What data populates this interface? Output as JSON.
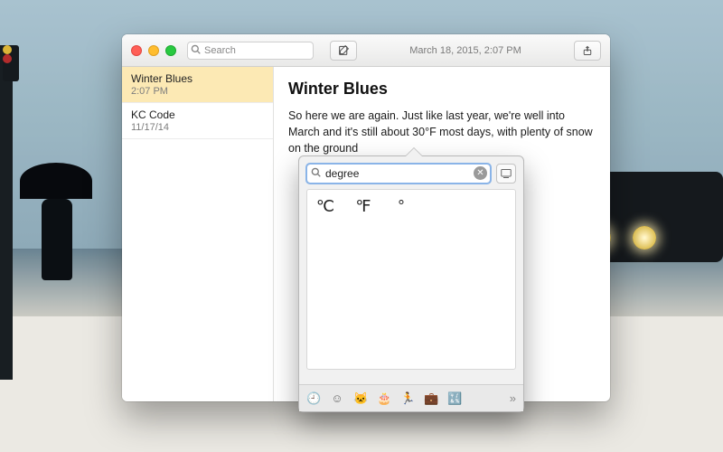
{
  "header": {
    "sidebar_search_placeholder": "Search",
    "date_label": "March 18, 2015, 2:07 PM"
  },
  "sidebar": {
    "items": [
      {
        "title": "Winter Blues",
        "subtitle": "2:07 PM",
        "selected": true
      },
      {
        "title": "KC Code",
        "subtitle": "11/17/14",
        "selected": false
      }
    ]
  },
  "editor": {
    "title": "Winter Blues",
    "body": "So here we are again. Just like last year, we're well into March and it's still about 30°F most days, with plenty of snow on the ground"
  },
  "char_viewer": {
    "search_value": "degree",
    "results": [
      {
        "char": "℃",
        "name": "degree-celsius"
      },
      {
        "char": "℉",
        "name": "degree-fahrenheit"
      },
      {
        "char": "°",
        "name": "degree-sign"
      }
    ],
    "categories": [
      {
        "icon": "🕘",
        "name": "recent"
      },
      {
        "icon": "☺",
        "name": "smileys"
      },
      {
        "icon": "🐱",
        "name": "animals"
      },
      {
        "icon": "🎂",
        "name": "food"
      },
      {
        "icon": "🏃",
        "name": "activity"
      },
      {
        "icon": "💼",
        "name": "objects"
      },
      {
        "icon": "🔣",
        "name": "symbols"
      }
    ]
  }
}
